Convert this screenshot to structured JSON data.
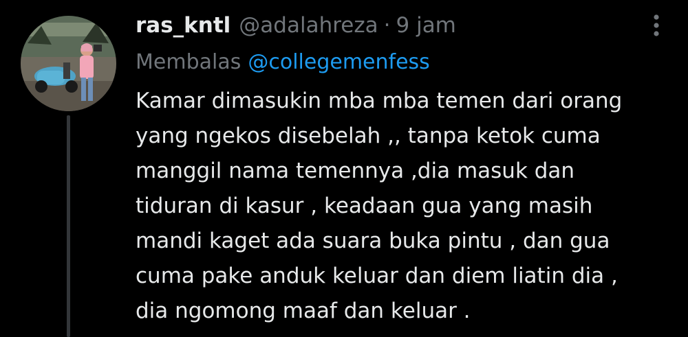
{
  "tweet": {
    "display_name": "ras_kntl",
    "handle": "@adalahreza",
    "separator": "·",
    "time": "9 jam",
    "replying_label": "Membalas",
    "replying_to": "@collegemenfess",
    "body_lines": [
      "Kamar dimasukin mba mba temen dari orang",
      "yang ngekos disebelah ,, tanpa ketok cuma",
      "manggil nama temennya ,dia masuk dan",
      "tiduran di kasur , keadaan gua yang masih",
      "mandi kaget ada suara buka pintu , dan gua",
      "cuma pake anduk keluar dan diem liatin dia ,",
      "dia ngomong maaf dan keluar ."
    ]
  },
  "icons": {
    "avatar": "profile-photo-person-with-scooter",
    "more": "more-vertical-icon"
  },
  "colors": {
    "background": "#000000",
    "primary_text": "#e7e9ea",
    "secondary_text": "#71767b",
    "link": "#1d9bf0",
    "thread_line": "#333639"
  }
}
